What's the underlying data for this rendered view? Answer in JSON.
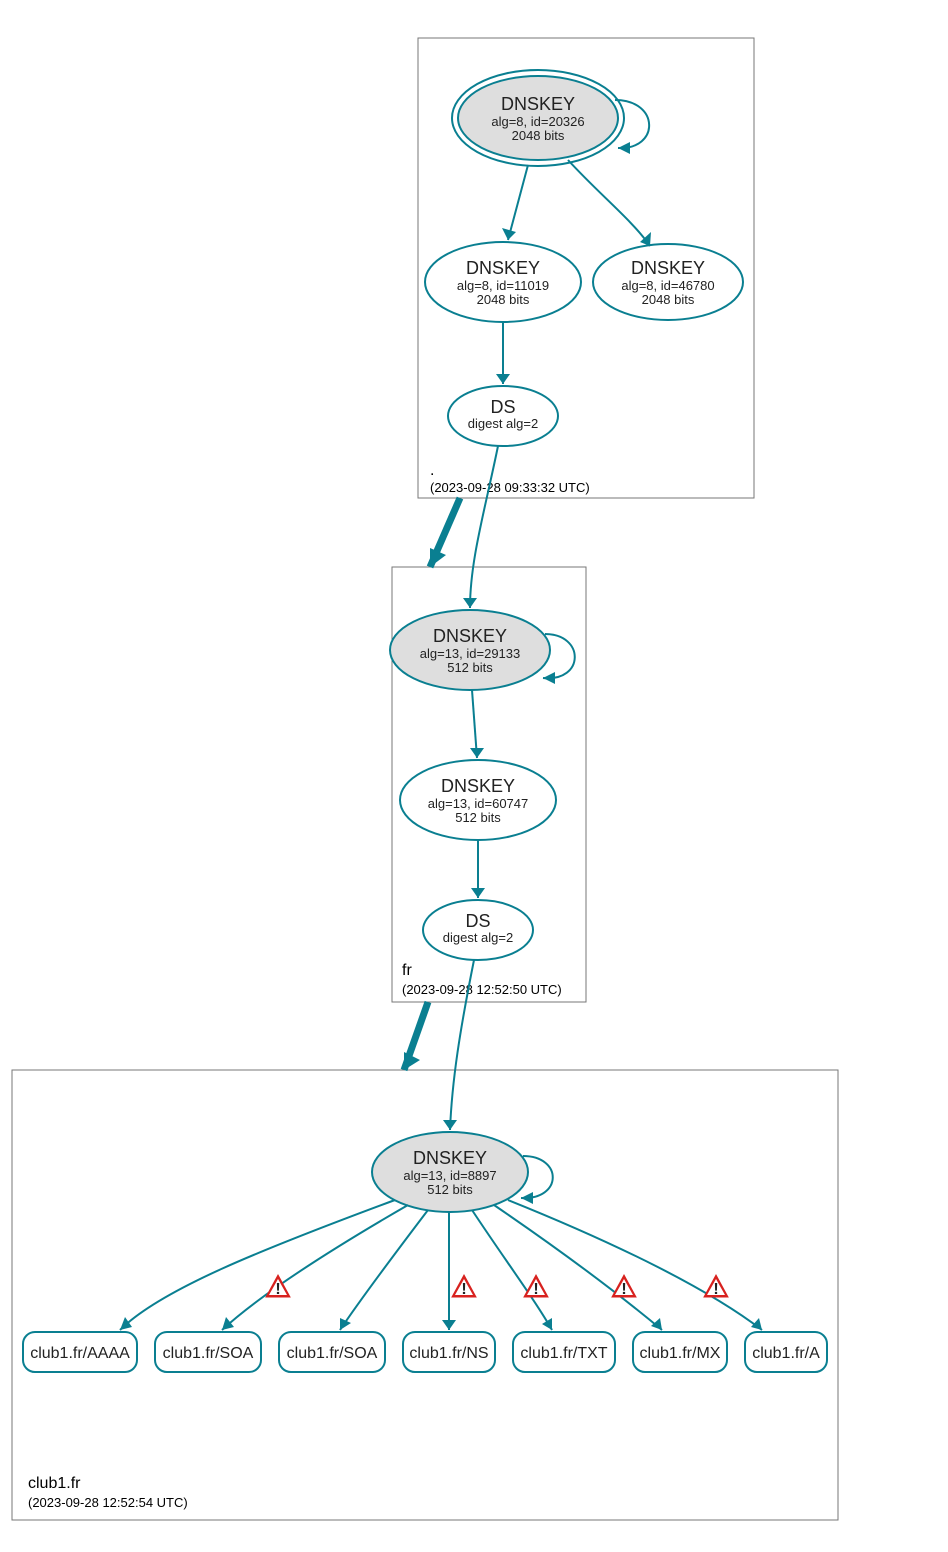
{
  "colors": {
    "teal": "#0a7f91",
    "border": "#777777",
    "grey": "#dedede"
  },
  "zones": {
    "root": {
      "label": ".",
      "sub": "(2023-09-28 09:33:32 UTC)"
    },
    "fr": {
      "label": "fr",
      "sub": "(2023-09-28 12:52:50 UTC)"
    },
    "club1": {
      "label": "club1.fr",
      "sub": "(2023-09-28 12:52:54 UTC)"
    }
  },
  "nodes": {
    "rootKSK": {
      "title": "DNSKEY",
      "line2": "alg=8, id=20326",
      "line3": "2048 bits"
    },
    "rootZSK1": {
      "title": "DNSKEY",
      "line2": "alg=8, id=11019",
      "line3": "2048 bits"
    },
    "rootZSK2": {
      "title": "DNSKEY",
      "line2": "alg=8, id=46780",
      "line3": "2048 bits"
    },
    "rootDS": {
      "title": "DS",
      "line2": "digest alg=2",
      "line3": ""
    },
    "frKSK": {
      "title": "DNSKEY",
      "line2": "alg=13, id=29133",
      "line3": "512 bits"
    },
    "frZSK": {
      "title": "DNSKEY",
      "line2": "alg=13, id=60747",
      "line3": "512 bits"
    },
    "frDS": {
      "title": "DS",
      "line2": "digest alg=2",
      "line3": ""
    },
    "clubKSK": {
      "title": "DNSKEY",
      "line2": "alg=13, id=8897",
      "line3": "512 bits"
    }
  },
  "rr": {
    "aaaa": "club1.fr/AAAA",
    "soa1": "club1.fr/SOA",
    "soa2": "club1.fr/SOA",
    "ns": "club1.fr/NS",
    "txt": "club1.fr/TXT",
    "mx": "club1.fr/MX",
    "a": "club1.fr/A"
  },
  "warning_glyph": "⚠"
}
